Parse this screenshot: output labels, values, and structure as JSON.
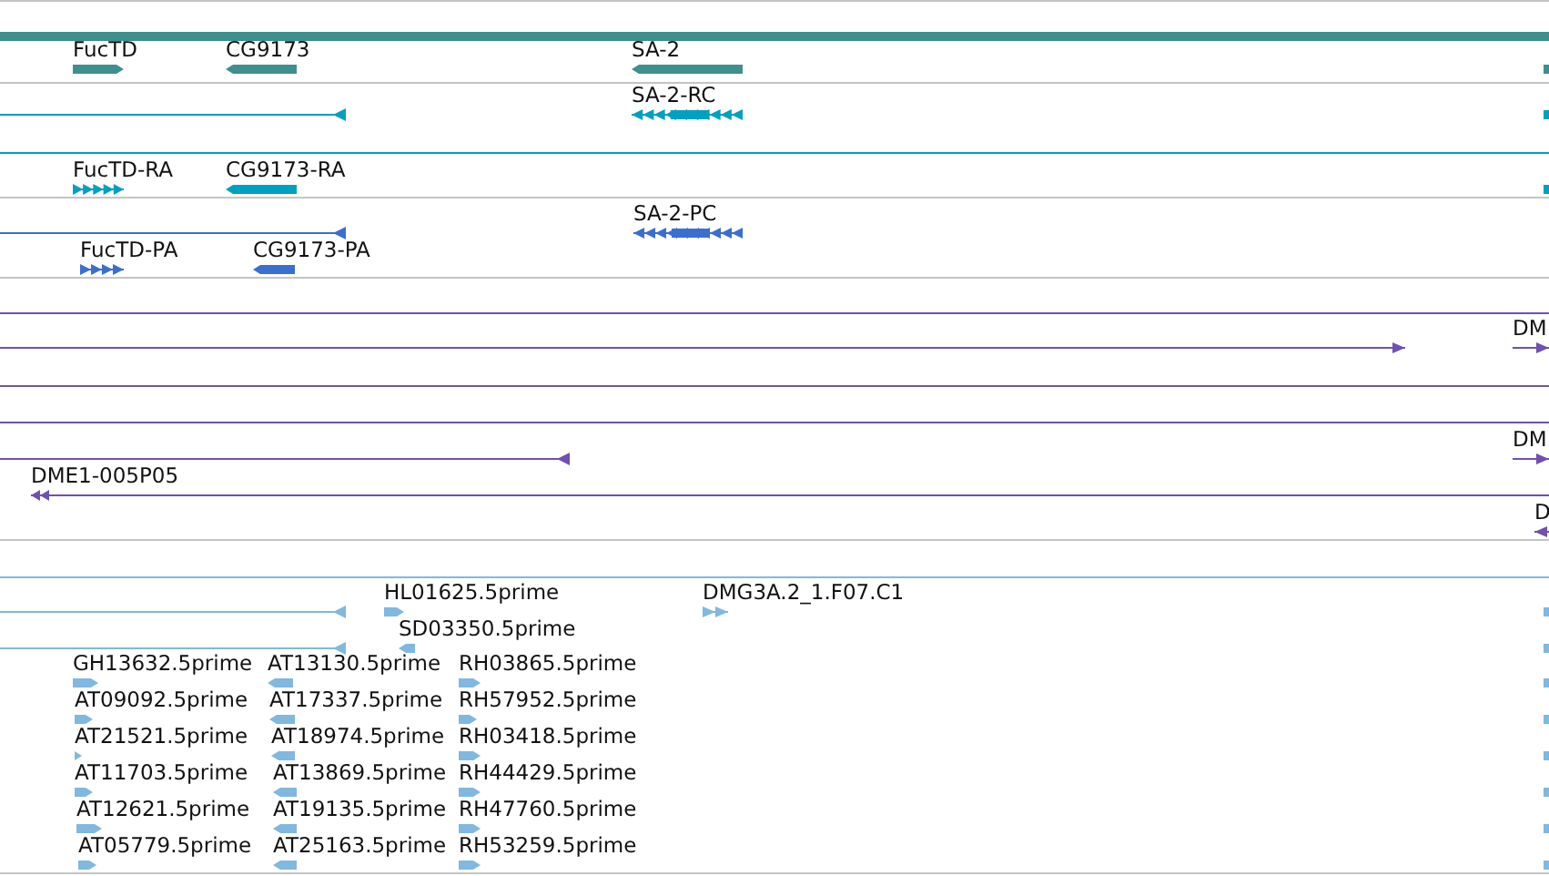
{
  "tracks": [
    {
      "color": "#3f8f8f",
      "features": [
        {
          "kind": "bar"
        },
        {
          "kind": "bar",
          "label": "FucTD",
          "reverse": false
        },
        {
          "kind": "bar",
          "label": "CG9173",
          "reverse": true
        },
        {
          "kind": "bar",
          "label": "SA-2",
          "reverse": true
        },
        {
          "kind": "bar"
        }
      ]
    },
    {
      "color": "#00a0c0",
      "features": [
        {
          "kind": "line",
          "reverse": true
        },
        {
          "kind": "exons",
          "label": "SA-2-RC",
          "reverse": true
        },
        {
          "kind": "bar"
        },
        {
          "kind": "line"
        },
        {
          "kind": "exons",
          "label": "FucTD-RA",
          "reverse": false
        },
        {
          "kind": "bar",
          "label": "CG9173-RA",
          "reverse": true
        },
        {
          "kind": "bar"
        }
      ]
    },
    {
      "color": "#3a6fd0",
      "features": [
        {
          "kind": "line",
          "reverse": true
        },
        {
          "kind": "exons",
          "label": "SA-2-PC",
          "reverse": true
        },
        {
          "kind": "exons",
          "label": "FucTD-PA",
          "reverse": false
        },
        {
          "kind": "bar",
          "label": "CG9173-PA",
          "reverse": true
        }
      ]
    },
    {
      "color": "#7050b0",
      "features": [
        {
          "kind": "line"
        },
        {
          "kind": "line",
          "reverse": false
        },
        {
          "kind": "line",
          "label": "DM",
          "reverse": false
        },
        {
          "kind": "line"
        },
        {
          "kind": "line"
        },
        {
          "kind": "line",
          "reverse": true
        },
        {
          "kind": "line",
          "label": "DM",
          "reverse": false
        },
        {
          "kind": "line",
          "label": "DME1-005P05",
          "reverse": true
        },
        {
          "kind": "line",
          "label": "D",
          "reverse": true
        }
      ]
    },
    {
      "color": "#80b8e0",
      "features": [
        {
          "kind": "line"
        },
        {
          "kind": "line",
          "reverse": true
        },
        {
          "kind": "bar",
          "label": "HL01625.5prime",
          "reverse": false
        },
        {
          "kind": "exons",
          "label": "DMG3A.2_1.F07.C1",
          "reverse": false
        },
        {
          "kind": "line",
          "reverse": true
        },
        {
          "kind": "bar",
          "label": "SD03350.5prime",
          "reverse": true
        },
        {
          "kind": "bar",
          "label": "GH13632.5prime",
          "reverse": false
        },
        {
          "kind": "bar",
          "label": "AT13130.5prime",
          "reverse": true
        },
        {
          "kind": "bar",
          "label": "RH03865.5prime",
          "reverse": false
        },
        {
          "kind": "bar",
          "label": "AT09092.5prime",
          "reverse": false
        },
        {
          "kind": "bar",
          "label": "AT17337.5prime",
          "reverse": true
        },
        {
          "kind": "bar",
          "label": "RH57952.5prime",
          "reverse": false
        },
        {
          "kind": "bar",
          "label": "AT21521.5prime",
          "reverse": false
        },
        {
          "kind": "bar",
          "label": "AT18974.5prime",
          "reverse": true
        },
        {
          "kind": "bar",
          "label": "RH03418.5prime",
          "reverse": false
        },
        {
          "kind": "bar",
          "label": "AT11703.5prime",
          "reverse": false
        },
        {
          "kind": "bar",
          "label": "AT13869.5prime",
          "reverse": true
        },
        {
          "kind": "bar",
          "label": "RH44429.5prime",
          "reverse": false
        },
        {
          "kind": "bar",
          "label": "AT12621.5prime",
          "reverse": false
        },
        {
          "kind": "bar",
          "label": "AT19135.5prime",
          "reverse": true
        },
        {
          "kind": "bar",
          "label": "RH47760.5prime",
          "reverse": false
        },
        {
          "kind": "bar",
          "label": "AT05779.5prime",
          "reverse": false
        },
        {
          "kind": "bar",
          "label": "AT25163.5prime",
          "reverse": true
        },
        {
          "kind": "bar",
          "label": "RH53259.5prime",
          "reverse": false
        },
        {
          "kind": "bar"
        },
        {
          "kind": "bar"
        },
        {
          "kind": "bar"
        },
        {
          "kind": "bar"
        },
        {
          "kind": "bar"
        },
        {
          "kind": "bar"
        },
        {
          "kind": "bar"
        },
        {
          "kind": "bar"
        }
      ]
    }
  ]
}
